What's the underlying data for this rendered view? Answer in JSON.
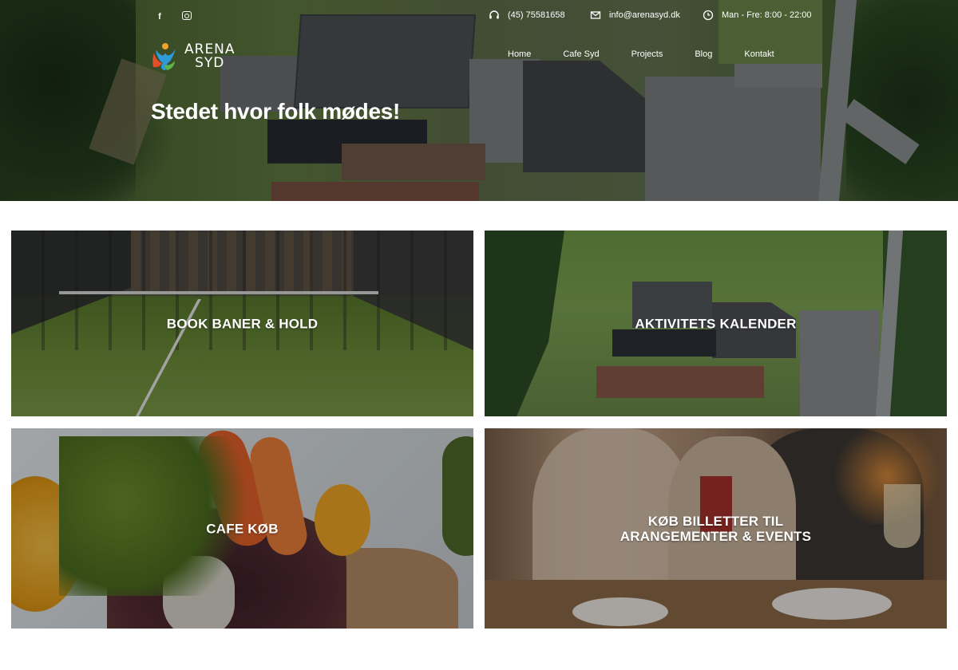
{
  "header": {
    "social": {
      "facebook_icon": "facebook-icon",
      "instagram_icon": "instagram-icon"
    },
    "contact": {
      "phone": "(45) 75581658",
      "email": "info@arenasyd.dk",
      "hours": "Man - Fre: 8:00 - 22:00"
    },
    "logo": {
      "line1": "ARENA",
      "line2": "SYD"
    },
    "nav": [
      "Home",
      "Cafe Syd",
      "Projects",
      "Blog",
      "Kontakt"
    ],
    "hero_title": "Stedet hvor folk mødes!"
  },
  "tiles": [
    {
      "label": "BOOK BANER & HOLD"
    },
    {
      "label": "AKTIVITETS KALENDER"
    },
    {
      "label": "CAFE KØB"
    },
    {
      "label_line1": "KØB BILLETTER TIL",
      "label_line2": "ARANGEMENTER & EVENTS"
    }
  ],
  "colors": {
    "overlay": "#000000",
    "text": "#ffffff",
    "background": "#ffffff"
  }
}
